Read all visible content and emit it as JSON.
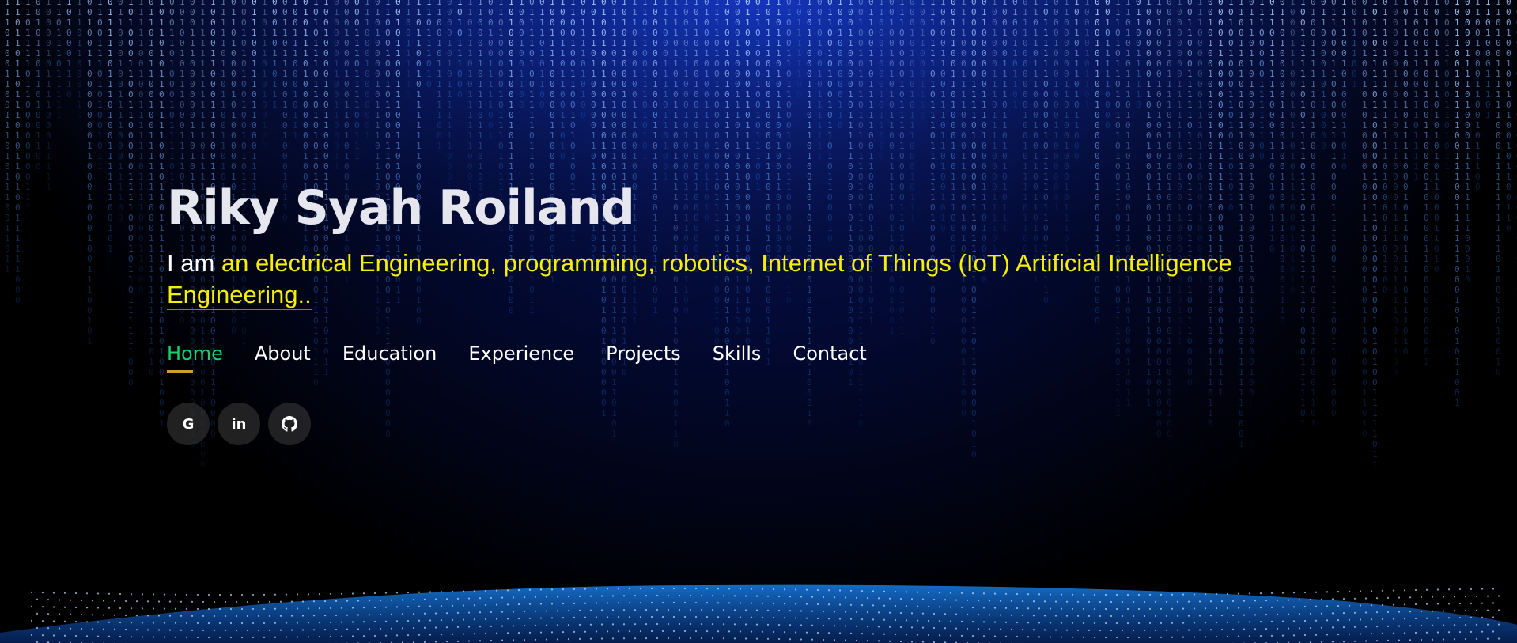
{
  "hero": {
    "name": "Riky Syah Roiland",
    "tagline_prefix": "I am ",
    "tagline_typed": "an electrical Engineering, programming, robotics, Internet of Things (IoT) Artificial Intelligence Engineering.."
  },
  "nav": {
    "items": [
      {
        "label": "Home",
        "active": true
      },
      {
        "label": "About"
      },
      {
        "label": "Education"
      },
      {
        "label": "Experience"
      },
      {
        "label": "Projects"
      },
      {
        "label": "Skills"
      },
      {
        "label": "Contact"
      }
    ]
  },
  "social": {
    "google": {
      "glyph": "G",
      "icon": "google-icon"
    },
    "linkedin": {
      "glyph": "in",
      "icon": "linkedin-icon"
    },
    "github": {
      "glyph": "github",
      "icon": "github-icon"
    }
  },
  "colors": {
    "name": "#e6e6ee",
    "typed_text": "#f5ef00",
    "active_nav": "#18d26e",
    "nav_underline": "#c9a227",
    "matrix_blue": "#2a7bff"
  }
}
